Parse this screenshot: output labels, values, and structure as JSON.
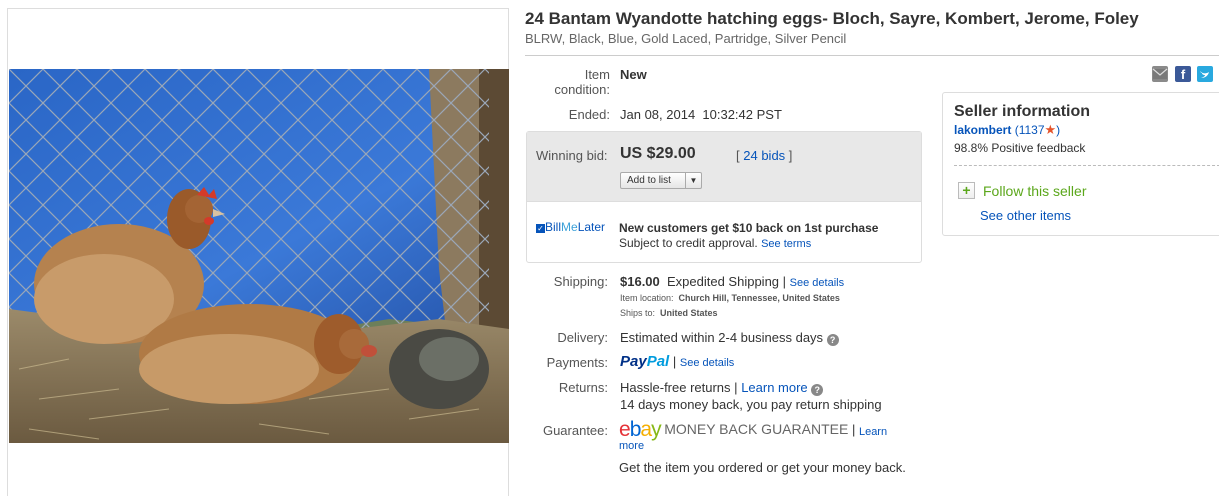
{
  "listing": {
    "title": "24 Bantam Wyandotte hatching eggs- Bloch, Sayre, Kombert, Jerome, Foley",
    "subtitle": "BLRW, Black, Blue, Gold Laced, Partridge, Silver Pencil"
  },
  "details": {
    "condition_label_1": "Item",
    "condition_label_2": "condition:",
    "condition_value": "New",
    "ended_label": "Ended:",
    "ended_value": "Jan 08, 2014  10:32:42 PST"
  },
  "share_icons": [
    "email-icon",
    "facebook-icon",
    "twitter-icon"
  ],
  "bid": {
    "label": "Winning bid:",
    "amount": "US $29.00",
    "bids_open": "[",
    "bids_link": "24 bids",
    "bids_close": "]",
    "add_to_list": "Add to list",
    "dropdown": "▼"
  },
  "billmelater": {
    "logo_bill": "Bill",
    "logo_me": "Me",
    "logo_later": "Later",
    "headline": "New customers get $10 back on 1st purchase",
    "sub": "Subject to credit approval.",
    "link": "See terms"
  },
  "shipping": {
    "label": "Shipping:",
    "cost": "$16.00",
    "method": "Expedited Shipping",
    "sep": "|",
    "link": "See details",
    "location_label": "Item location:",
    "location": "Church Hill, Tennessee, United States",
    "ships_to_label": "Ships to:",
    "ships_to": "United States"
  },
  "delivery": {
    "label": "Delivery:",
    "value": "Estimated within 2-4 business days"
  },
  "payments": {
    "label": "Payments:",
    "paypal_pay": "Pay",
    "paypal_pal": "Pal",
    "sep": "|",
    "link": "See details"
  },
  "returns": {
    "label": "Returns:",
    "value": "Hassle-free returns",
    "sep": "|",
    "link": "Learn more",
    "detail": "14 days money back, you pay return shipping"
  },
  "guarantee": {
    "label": "Guarantee:",
    "ebay_e": "e",
    "ebay_b": "b",
    "ebay_a": "a",
    "ebay_y": "y",
    "mbg": "MONEY BACK GUARANTEE",
    "sep": "|",
    "link_1": "Learn",
    "link_2": "more",
    "detail": "Get the item you ordered or get your money back."
  },
  "seller": {
    "heading": "Seller information",
    "username": "lakombert",
    "score": "(1137",
    "score_close": ")",
    "feedback": "98.8% Positive feedback",
    "follow": "Follow this seller",
    "see_items": "See other items"
  },
  "colors": {
    "link": "#0654ba",
    "ebay_red": "#e53238",
    "ebay_blue": "#0064d2",
    "ebay_yellow": "#f5af02",
    "ebay_green": "#86b817",
    "paypal_dark": "#003087",
    "paypal_light": "#009cde",
    "follow_green": "#5ba71b"
  }
}
